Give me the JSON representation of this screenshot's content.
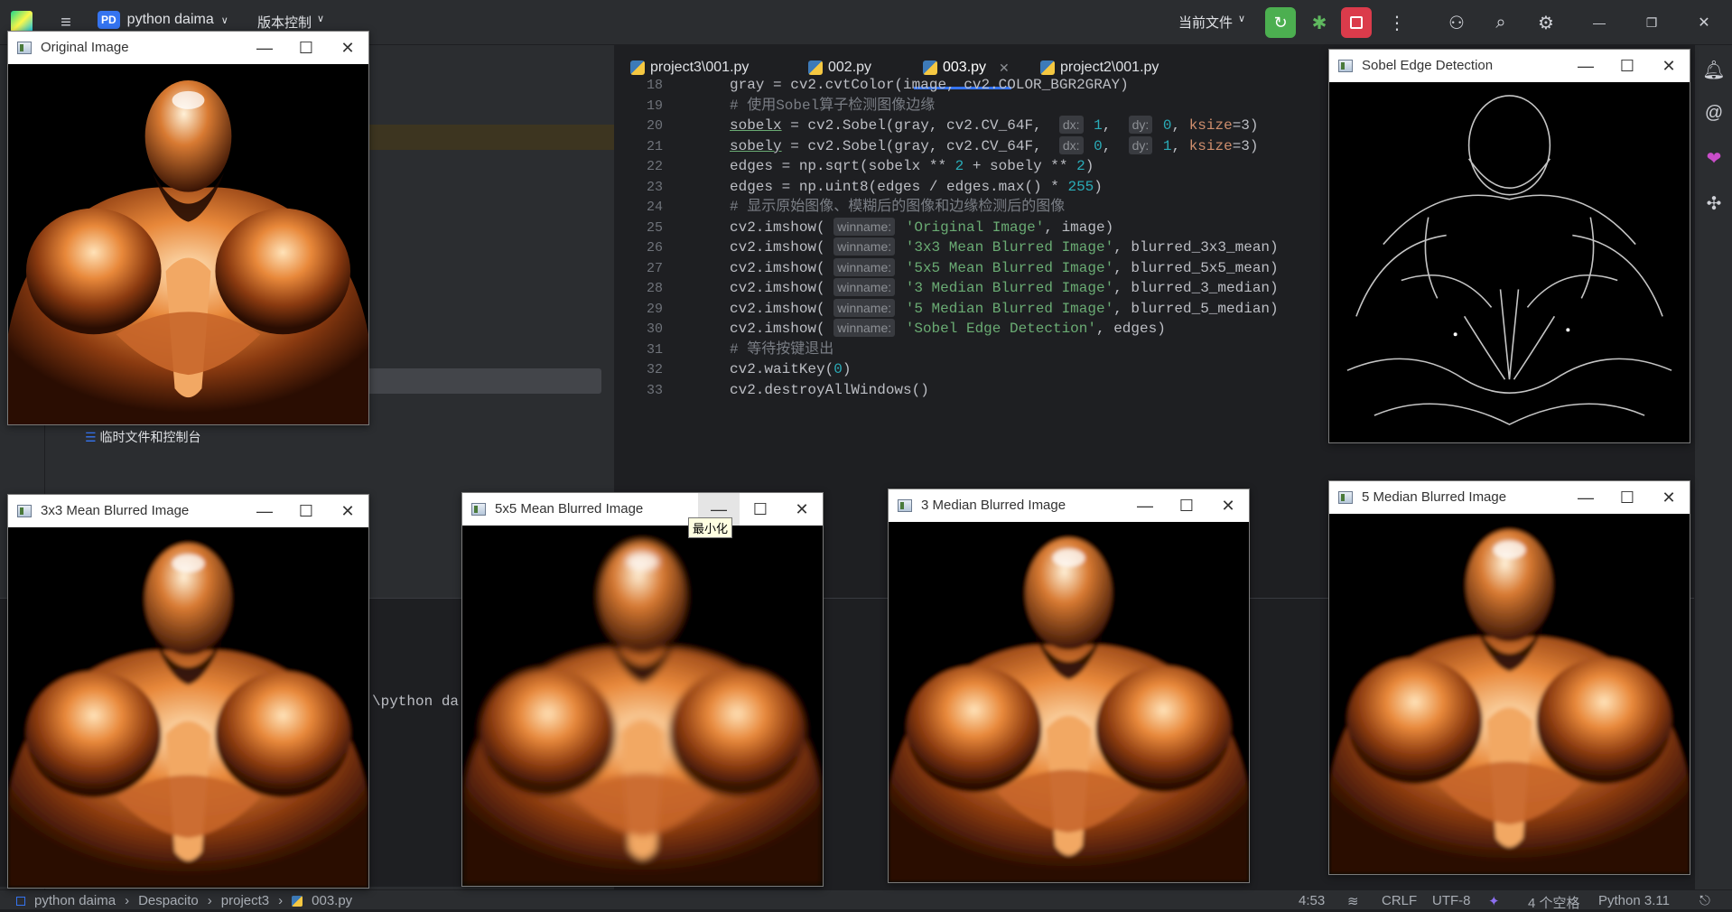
{
  "topbar": {
    "project_badge": "PD",
    "project_name": "python daima",
    "vcs_menu": "版本控制",
    "run_config": "当前文件"
  },
  "left_panel": {
    "scratch_label": "临时文件和控制台"
  },
  "editor": {
    "tabs": [
      {
        "label": "project3\\001.py"
      },
      {
        "label": "002.py"
      },
      {
        "label": "003.py",
        "active": true
      },
      {
        "label": "project2\\001.py"
      }
    ],
    "lines": [
      {
        "num": "18",
        "text": "gray = cv2.cvtColor(image, cv2.COLOR_BGR2GRAY)"
      },
      {
        "num": "19",
        "text": "# 使用Sobel算子检测图像边缘"
      },
      {
        "num": "20",
        "text": "sobelx = cv2.Sobel(gray, cv2.CV_64F,  dx: 1,  dy: 0, ksize=3)"
      },
      {
        "num": "21",
        "text": "sobely = cv2.Sobel(gray, cv2.CV_64F,  dx: 0,  dy: 1, ksize=3)"
      },
      {
        "num": "22",
        "text": "edges = np.sqrt(sobelx ** 2 + sobely ** 2)"
      },
      {
        "num": "23",
        "text": "edges = np.uint8(edges / edges.max() * 255)"
      },
      {
        "num": "24",
        "text": "# 显示原始图像、模糊后的图像和边缘检测后的图像"
      },
      {
        "num": "25",
        "text": "cv2.imshow( winname: 'Original Image', image)"
      },
      {
        "num": "26",
        "text": "cv2.imshow( winname: '3x3 Mean Blurred Image', blurred_3x3_mean)"
      },
      {
        "num": "27",
        "text": "cv2.imshow( winname: '5x5 Mean Blurred Image', blurred_5x5_mean)"
      },
      {
        "num": "28",
        "text": "cv2.imshow( winname: '3 Median Blurred Image', blurred_3_median)"
      },
      {
        "num": "29",
        "text": "cv2.imshow( winname: '5 Median Blurred Image', blurred_5_median)"
      },
      {
        "num": "30",
        "text": "cv2.imshow( winname: 'Sobel Edge Detection', edges)"
      },
      {
        "num": "31",
        "text": "# 等待按键退出"
      },
      {
        "num": "32",
        "text": "cv2.waitKey(0)"
      },
      {
        "num": "33",
        "text": "cv2.destroyAllWindows()"
      }
    ]
  },
  "terminal": {
    "text": "\\python da"
  },
  "windows": {
    "original": {
      "title": "Original Image"
    },
    "mean3": {
      "title": "3x3 Mean Blurred Image"
    },
    "mean5": {
      "title": "5x5 Mean Blurred Image",
      "tooltip": "最小化"
    },
    "median3": {
      "title": "3 Median Blurred Image"
    },
    "median5": {
      "title": "5 Median Blurred Image"
    },
    "sobel": {
      "title": "Sobel Edge Detection"
    }
  },
  "status": {
    "breadcrumb": [
      "python daima",
      "Despacito",
      "project3",
      "003.py"
    ],
    "position": "4:53",
    "line_sep": "CRLF",
    "encoding": "UTF-8",
    "indent": "4 个空格",
    "interpreter": "Python 3.11"
  },
  "colors": {
    "accent": "#3574f0",
    "run_green": "#4caf50",
    "stop_red": "#db3b4b"
  }
}
